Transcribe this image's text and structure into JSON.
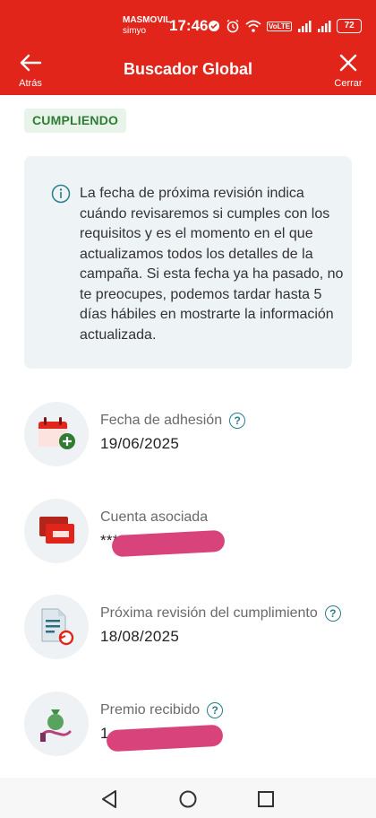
{
  "colors": {
    "brand": "#e2251b",
    "success": "#2e7d32",
    "info_bg": "#eef3f6",
    "teal": "#2a7d8c",
    "redaction": "#d9437c"
  },
  "status_bar": {
    "carrier": "MASMOVIL",
    "carrier_sub": "simyo",
    "time": "17:46",
    "battery": "72",
    "volte": "VoLTE"
  },
  "header": {
    "title": "Buscador Global",
    "back_label": "Atrás",
    "close_label": "Cerrar"
  },
  "badge": "CUMPLIENDO",
  "info": {
    "icon": "info-icon",
    "text": "La fecha de próxima revisión indica cuándo revisaremos si cumples con los requisitos y es el momento en el que actualizamos todos los detalles de la campaña. Si esta fecha ya ha pasado, no te preocupes, podemos tardar hasta 5 días hábiles en mostrarte la información actualizada."
  },
  "details": [
    {
      "icon": "calendar-add-icon",
      "label": "Fecha de adhesión",
      "value": "19/06/2025",
      "help": "?"
    },
    {
      "icon": "cards-icon",
      "label": "Cuenta asociada",
      "value": "****",
      "help": ""
    },
    {
      "icon": "document-refresh-icon",
      "label": "Próxima revisión del cumplimiento",
      "value": "18/08/2025",
      "help": "?"
    },
    {
      "icon": "money-bag-hand-icon",
      "label": "Premio recibido",
      "value": "1",
      "help": "?"
    }
  ]
}
